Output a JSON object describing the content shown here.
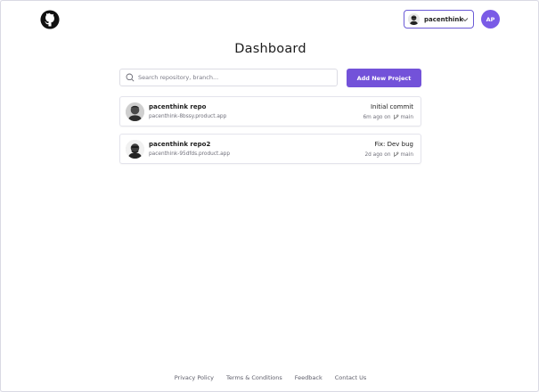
{
  "header": {
    "user_name": "pacenthink",
    "avatar_initials": "AP"
  },
  "main": {
    "title": "Dashboard",
    "search_placeholder": "Search repository, branch...",
    "add_button_label": "Add New Project",
    "projects": [
      {
        "name": "pacenthink repo",
        "url": "pacenthink-8bssy.product.app",
        "commit": "Initial commit",
        "time": "6m ago on",
        "branch": "main"
      },
      {
        "name": "pacenthink repo2",
        "url": "pacenthink-95dfds.product.app",
        "commit": "Fix: Dev bug",
        "time": "2d ago on",
        "branch": "main"
      }
    ]
  },
  "footer": {
    "links": [
      "Privacy Policy",
      "Terms & Conditions",
      "Feedback",
      "Contact Us"
    ]
  },
  "colors": {
    "accent": "#7352d9",
    "avatar_bg": "#7a5be6",
    "border": "#e4e4ec"
  }
}
